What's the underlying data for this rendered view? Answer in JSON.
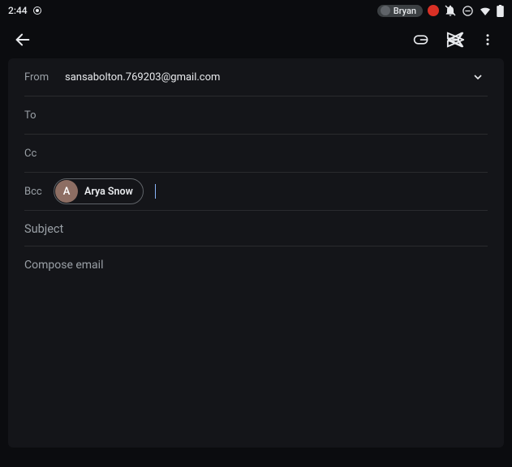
{
  "statusbar": {
    "time": "2:44",
    "user_name": "Bryan"
  },
  "toolbar": {
    "back": "Back",
    "attach": "Attach",
    "send": "Send",
    "more": "More"
  },
  "compose": {
    "from_label": "From",
    "from_value": "sansabolton.769203@gmail.com",
    "to_label": "To",
    "cc_label": "Cc",
    "bcc_label": "Bcc",
    "bcc_chips": [
      {
        "initial": "A",
        "name": "Arya Snow"
      }
    ],
    "subject_placeholder": "Subject",
    "body_placeholder": "Compose email"
  }
}
